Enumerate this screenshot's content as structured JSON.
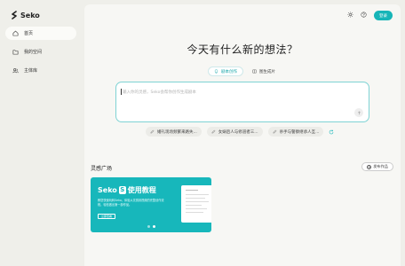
{
  "app": {
    "logo_text": "Seko"
  },
  "sidebar": {
    "items": [
      {
        "label": "首页",
        "icon": "home-icon",
        "active": true
      },
      {
        "label": "我的空间",
        "icon": "folder-icon",
        "active": false
      },
      {
        "label": "主体库",
        "icon": "users-icon",
        "active": false
      }
    ]
  },
  "header": {
    "icons": [
      "sun-icon",
      "help-icon"
    ],
    "login_label": "登录"
  },
  "main": {
    "headline": "今天有什么新的想法？",
    "tabs": [
      {
        "label": "剧本创作",
        "icon": "bulb-icon",
        "active": true
      },
      {
        "label": "图生成片",
        "icon": "image-icon",
        "active": false
      }
    ],
    "input": {
      "value": "",
      "placeholder": "输入你的灵感，Seko会帮你创作生成剧本"
    },
    "suggestions": [
      {
        "label": "婚礼现场频繁来路失..."
      },
      {
        "label": "女娲后人与修道者三..."
      },
      {
        "label": "杀手与警察继承人互..."
      }
    ]
  },
  "inspiration": {
    "title": "灵感广场",
    "publish_label": "发布作品",
    "card": {
      "title_prefix": "Seko",
      "badge": "S",
      "title_suffix": "使用教程",
      "desc": "教您快速玩转Seko，体验从灵感到视频的完整创作流程，轻松做出第一部作品。",
      "button_label": "立即查看"
    }
  },
  "colors": {
    "accent": "#17b5b8",
    "background": "#efefea",
    "panel": "#f7f7f4"
  }
}
